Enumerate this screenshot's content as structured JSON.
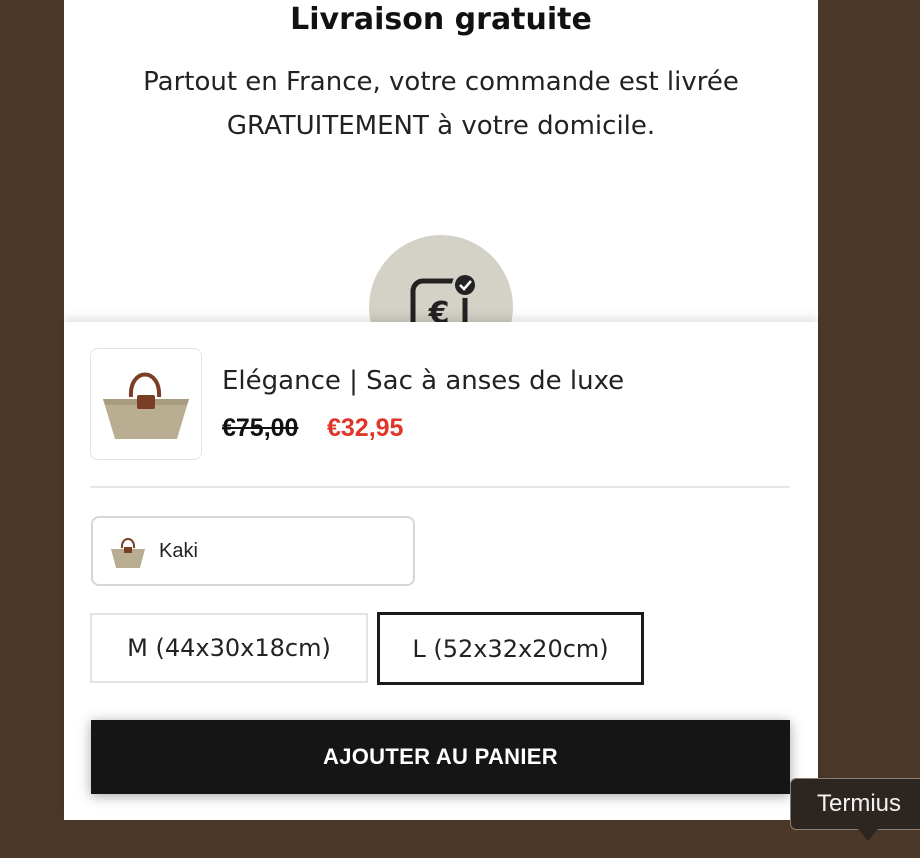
{
  "shipping": {
    "title": "Livraison gratuite",
    "description": "Partout en France, votre commande est livrée GRATUITEMENT à votre domicile."
  },
  "icons": {
    "payment": "euro-payment-check-icon",
    "product_thumbnail": "tote-bag-image",
    "color_swatch": "tote-bag-swatch"
  },
  "product": {
    "name": "Elégance | Sac à anses de luxe",
    "original_price": "€75,00",
    "sale_price": "€32,95"
  },
  "variant": {
    "color_label": "Kaki",
    "sizes": [
      {
        "label": "M (44x30x18cm)",
        "selected": false
      },
      {
        "label": "L (52x32x20cm)",
        "selected": true
      }
    ]
  },
  "cart": {
    "button_label": "AJOUTER AU PANIER"
  },
  "tooltip": {
    "text": "Termius"
  },
  "colors": {
    "background": "#4c3829",
    "sale_price": "#e0352b",
    "cart_button": "#151515",
    "icon_circle": "#d4d1c7"
  }
}
